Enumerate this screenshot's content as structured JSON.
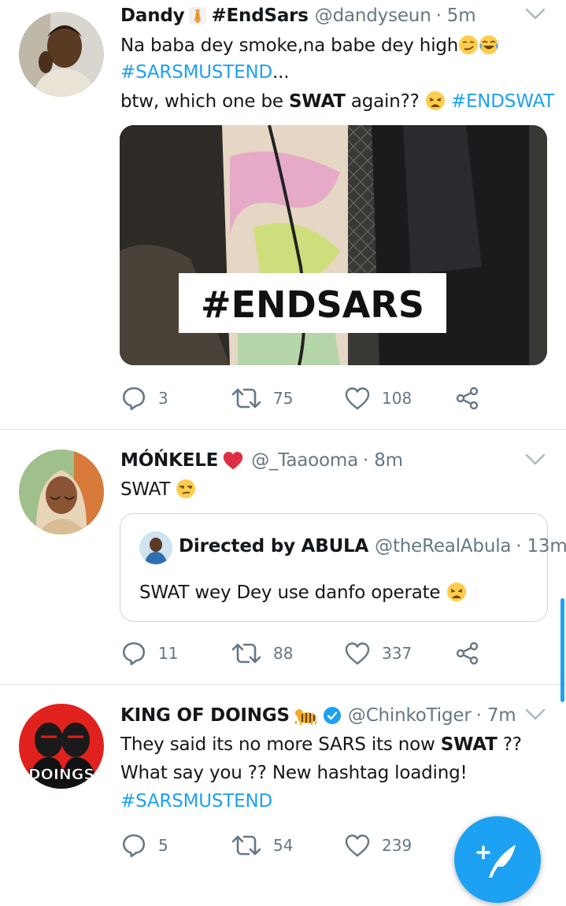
{
  "tweets": [
    {
      "name": "Dandy",
      "name_suffix": "#EndSars",
      "handle": "@dandyseun",
      "time": "· 5m",
      "line1": "Na baba dey smoke,na babe dey high",
      "line2_hashtag": "#SARSMUSTEND",
      "line2_rest": "...",
      "line3_pre": "btw, which one be ",
      "line3_bold": "SWAT",
      "line3_post": " again?? ",
      "line3_hashtag": "#ENDSWAT",
      "media_caption": "#ENDSARS",
      "replies": "3",
      "retweets": "75",
      "likes": "108"
    },
    {
      "name": "MÓŃKELE",
      "handle": "@_Taaooma",
      "time": "· 8m",
      "text": "SWAT",
      "quote": {
        "name": "Directed by ABULA",
        "handle": "@theRealAbula",
        "time": "· 13m",
        "text": "SWAT wey Dey use danfo operate"
      },
      "replies": "11",
      "retweets": "88",
      "likes": "337"
    },
    {
      "name": "KING OF DOINGS",
      "handle": "@ChinkoTiger",
      "time": "· 7m",
      "line1_pre": "They said its no more SARS its now ",
      "line1_bold": "SWAT",
      "line1_post": " ??",
      "line2": "What say you ?? New hashtag loading!",
      "line3_hashtag": "#SARSMUSTEND",
      "avatar_text": "DOINGS",
      "replies": "5",
      "retweets": "54",
      "likes": "239"
    }
  ],
  "colors": {
    "accent": "#1da1f2",
    "secondary_text": "#657786",
    "divider": "#e1e8ed",
    "heart": "#e0245e"
  },
  "icons": [
    "reply-icon",
    "retweet-icon",
    "like-icon",
    "share-icon",
    "chevron-down-icon",
    "compose-tweet-icon",
    "verified-badge-icon"
  ]
}
